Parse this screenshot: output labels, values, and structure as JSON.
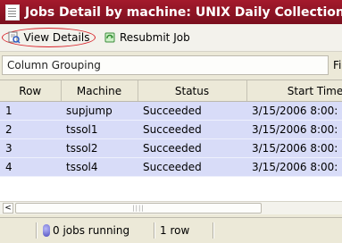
{
  "window": {
    "title": "Jobs Detail by machine: UNIX Daily Collection"
  },
  "toolbar": {
    "view_details_label": "View Details",
    "resubmit_label": "Resubmit Job"
  },
  "grouping": {
    "placeholder": "Column Grouping",
    "side_label": "Fi"
  },
  "table": {
    "headers": [
      "Row",
      "Machine",
      "Status",
      "Start Time"
    ],
    "rows": [
      [
        "1",
        "supjump",
        "Succeeded",
        "3/15/2006 8:00:"
      ],
      [
        "2",
        "tssol1",
        "Succeeded",
        "3/15/2006 8:00:"
      ],
      [
        "3",
        "tssol2",
        "Succeeded",
        "3/15/2006 8:00:"
      ],
      [
        "4",
        "tssol4",
        "Succeeded",
        "3/15/2006 8:00:"
      ]
    ]
  },
  "scrollbar": {
    "left_arrow": "<",
    "thumb_grip": "||||"
  },
  "status": {
    "jobs_running": "0 jobs running",
    "row_count": "1 row"
  },
  "colors": {
    "title_bar": "#A41A2C",
    "row_highlight": "#D8DCF8",
    "annotation_circle": "#D8232A"
  }
}
